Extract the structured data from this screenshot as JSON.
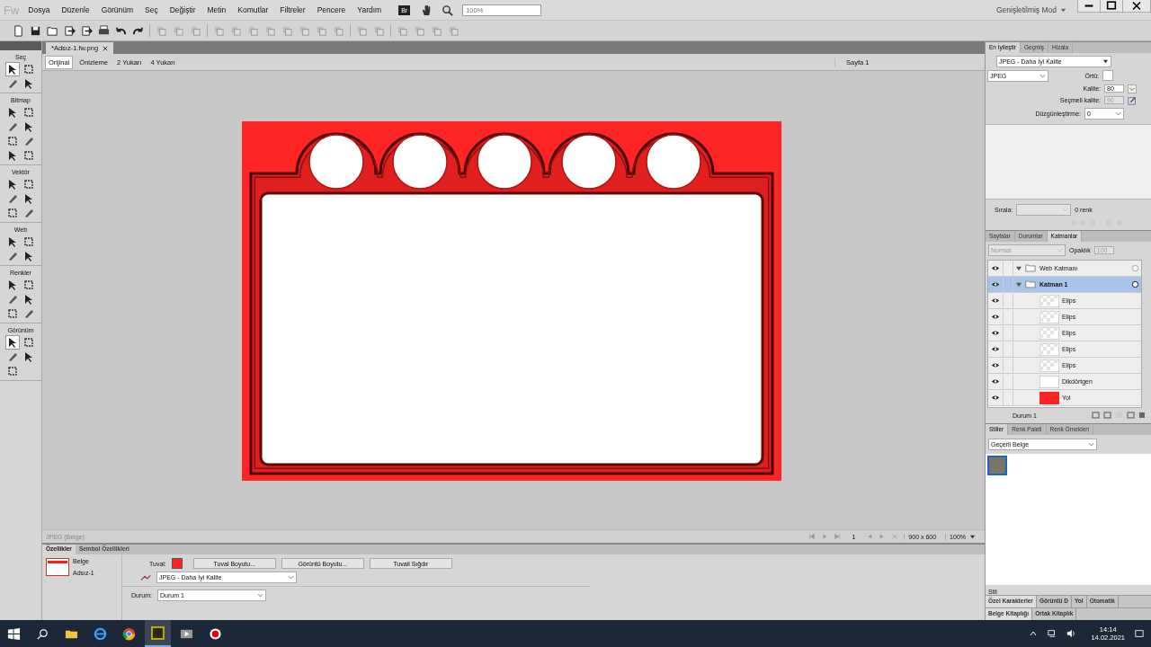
{
  "app": {
    "logo": "Fw",
    "menu": [
      "Dosya",
      "Düzenle",
      "Görünüm",
      "Seç",
      "Değiştir",
      "Metin",
      "Komutlar",
      "Filtreler",
      "Pencere",
      "Yardım"
    ],
    "bridge": "Br",
    "zoom": "100%",
    "mode": "Genişletilmiş Mod"
  },
  "document": {
    "tab": "*Adsız-1.fw.png",
    "views": [
      {
        "label": "Orijinal",
        "selected": true
      },
      {
        "label": "Önizleme",
        "selected": false
      },
      {
        "label": "2 Yukarı",
        "selected": false
      },
      {
        "label": "4 Yukarı",
        "selected": false
      }
    ],
    "page": "Sayfa 1"
  },
  "tools": [
    {
      "title": "Seç",
      "tools": [
        {
          "selected": true
        },
        {
          "selected": false
        },
        {
          "selected": false
        },
        {
          "selected": false
        }
      ]
    },
    {
      "title": "Bitmap",
      "tools": [
        {
          "selected": false
        },
        {
          "selected": false
        },
        {
          "selected": false
        },
        {
          "selected": false
        },
        {
          "selected": false
        },
        {
          "selected": false
        },
        {
          "selected": false
        },
        {
          "selected": false
        }
      ]
    },
    {
      "title": "Vektör",
      "tools": [
        {
          "selected": false
        },
        {
          "selected": false
        },
        {
          "selected": false
        },
        {
          "selected": false
        },
        {
          "selected": false
        },
        {
          "selected": false
        }
      ]
    },
    {
      "title": "Web",
      "tools": [
        {
          "selected": false
        },
        {
          "selected": false
        },
        {
          "selected": false
        },
        {
          "selected": false
        }
      ]
    },
    {
      "title": "Renkler",
      "tools": [
        {
          "selected": false
        },
        {
          "selected": false
        },
        {
          "selected": false
        },
        {
          "selected": false
        },
        {
          "selected": false
        },
        {
          "selected": false
        }
      ]
    },
    {
      "title": "Görünüm",
      "tools": [
        {
          "selected": true
        },
        {
          "selected": false
        },
        {
          "selected": false
        },
        {
          "selected": false
        },
        {
          "selected": false
        }
      ]
    }
  ],
  "status": {
    "format": "JPEG (Belge)",
    "frame": "1",
    "size": "900 x 600",
    "zoom": "100%"
  },
  "properties": {
    "tabs": [
      {
        "label": "Özellikler",
        "selected": true
      },
      {
        "label": "Sembol Özellikleri",
        "selected": false
      }
    ],
    "type": "Belge",
    "name": "Adsız-1",
    "canvas_label": "Tuval:",
    "buttons": [
      "Tuval Boyutu...",
      "Görüntü Boyutu...",
      "Tuvali Sığdır"
    ],
    "preset": "JPEG - Daha İyi Kalite",
    "state_label": "Durum:",
    "state": "Durum 1"
  },
  "optimize": {
    "tabs": [
      {
        "label": "En İyileştir",
        "selected": true
      },
      {
        "label": "Geçmiş",
        "selected": false
      },
      {
        "label": "Hizala",
        "selected": false
      }
    ],
    "preset": "JPEG - Daha İyi Kalite",
    "format": "JPEG",
    "matte_label": "Örtü:",
    "quality_label": "Kalite:",
    "quality": "80",
    "selective_label": "Seçmeli kalite:",
    "selective": "90",
    "smoothing_label": "Düzgünleştirme:",
    "smoothing": "0",
    "sort_label": "Sırala:",
    "colors": "0 renk"
  },
  "layers": {
    "tabs": [
      {
        "label": "Sayfalar",
        "selected": false
      },
      {
        "label": "Durumlar",
        "selected": false
      },
      {
        "label": "Katmanlar",
        "selected": true
      }
    ],
    "blend": "Normal",
    "opacity_label": "Opaklık",
    "opacity": "100",
    "items": [
      {
        "name": "Web Katmanı",
        "expanded": true,
        "selected": false
      },
      {
        "name": "Katman 1",
        "expanded": true,
        "selected": true,
        "children": [
          {
            "name": "Elips",
            "kind": "ellipse"
          },
          {
            "name": "Elips",
            "kind": "ellipse"
          },
          {
            "name": "Elips",
            "kind": "ellipse"
          },
          {
            "name": "Elips",
            "kind": "ellipse"
          },
          {
            "name": "Elips",
            "kind": "ellipse"
          },
          {
            "name": "Dikdörtgen",
            "kind": "rect"
          },
          {
            "name": "Yol",
            "kind": "path"
          }
        ]
      }
    ],
    "state": "Durum 1"
  },
  "styles": {
    "tabs": [
      {
        "label": "Stiller",
        "selected": true
      },
      {
        "label": "Renk Paleti",
        "selected": false
      },
      {
        "label": "Renk Örnekleri",
        "selected": false
      }
    ],
    "source": "Geçerli Belge",
    "label": "Stil"
  },
  "bottom_tabs": [
    [
      {
        "label": "Özel Karakterler",
        "selected": true
      },
      {
        "label": "Görüntü D",
        "selected": false
      },
      {
        "label": "Yol",
        "selected": false
      },
      {
        "label": "Otomatik",
        "selected": false
      }
    ],
    [
      {
        "label": "Belge Kitaplığı",
        "selected": true
      },
      {
        "label": "Ortak Kitaplık",
        "selected": false
      }
    ]
  ],
  "taskbar": {
    "time": "14:14",
    "date": "14.02.2021"
  }
}
